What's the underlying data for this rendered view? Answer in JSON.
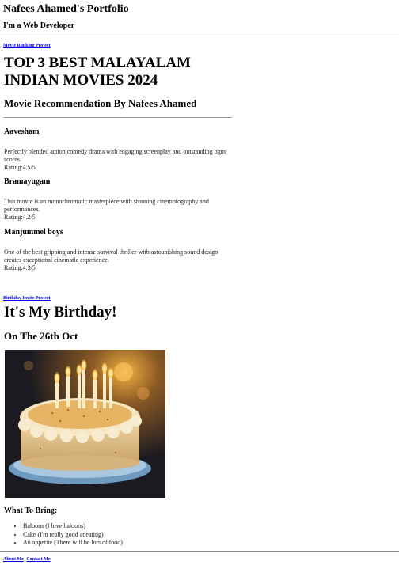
{
  "header": {
    "title": "Nafees Ahamed's Portfolio",
    "subtitle": "I'm a Web Developer"
  },
  "movie_section": {
    "link_label": "Movie Ranking Project",
    "title": "TOP 3 BEST MALAYALAM INDIAN MOVIES 2024",
    "subtitle": "Movie Recommendation By Nafees Ahamed",
    "movies": [
      {
        "title": "Aavesham",
        "description": "Perfectly blended action comedy drama with engaging screenplay and outstanding bgm scores.",
        "rating": "Rating:4.5/5"
      },
      {
        "title": "Bramayugam",
        "description": "This movie is an monochromatic masterpiece with stunning cinemotography and performances.",
        "rating": "Rating:4.2/5"
      },
      {
        "title": "Manjummel boys",
        "description": "One of the best gripping and intense survival thriller with astounishing sound design creates exceptional cinematic experience.",
        "rating": "Rating:4.3/5"
      }
    ]
  },
  "birthday_section": {
    "link_label": "Birthday Invite Project",
    "title": "It's My Birthday!",
    "date": "On The 26th Oct",
    "bring_title": "What To Bring:",
    "bring_items": [
      "Baloons (I love baloons)",
      "Cake (I'm really good at eating)",
      "An appetite (There will be lots of food)"
    ]
  },
  "footer": {
    "about_label": "About Me",
    "contact_label": "Contact Me"
  },
  "colors": {
    "link": "#0000ee"
  }
}
